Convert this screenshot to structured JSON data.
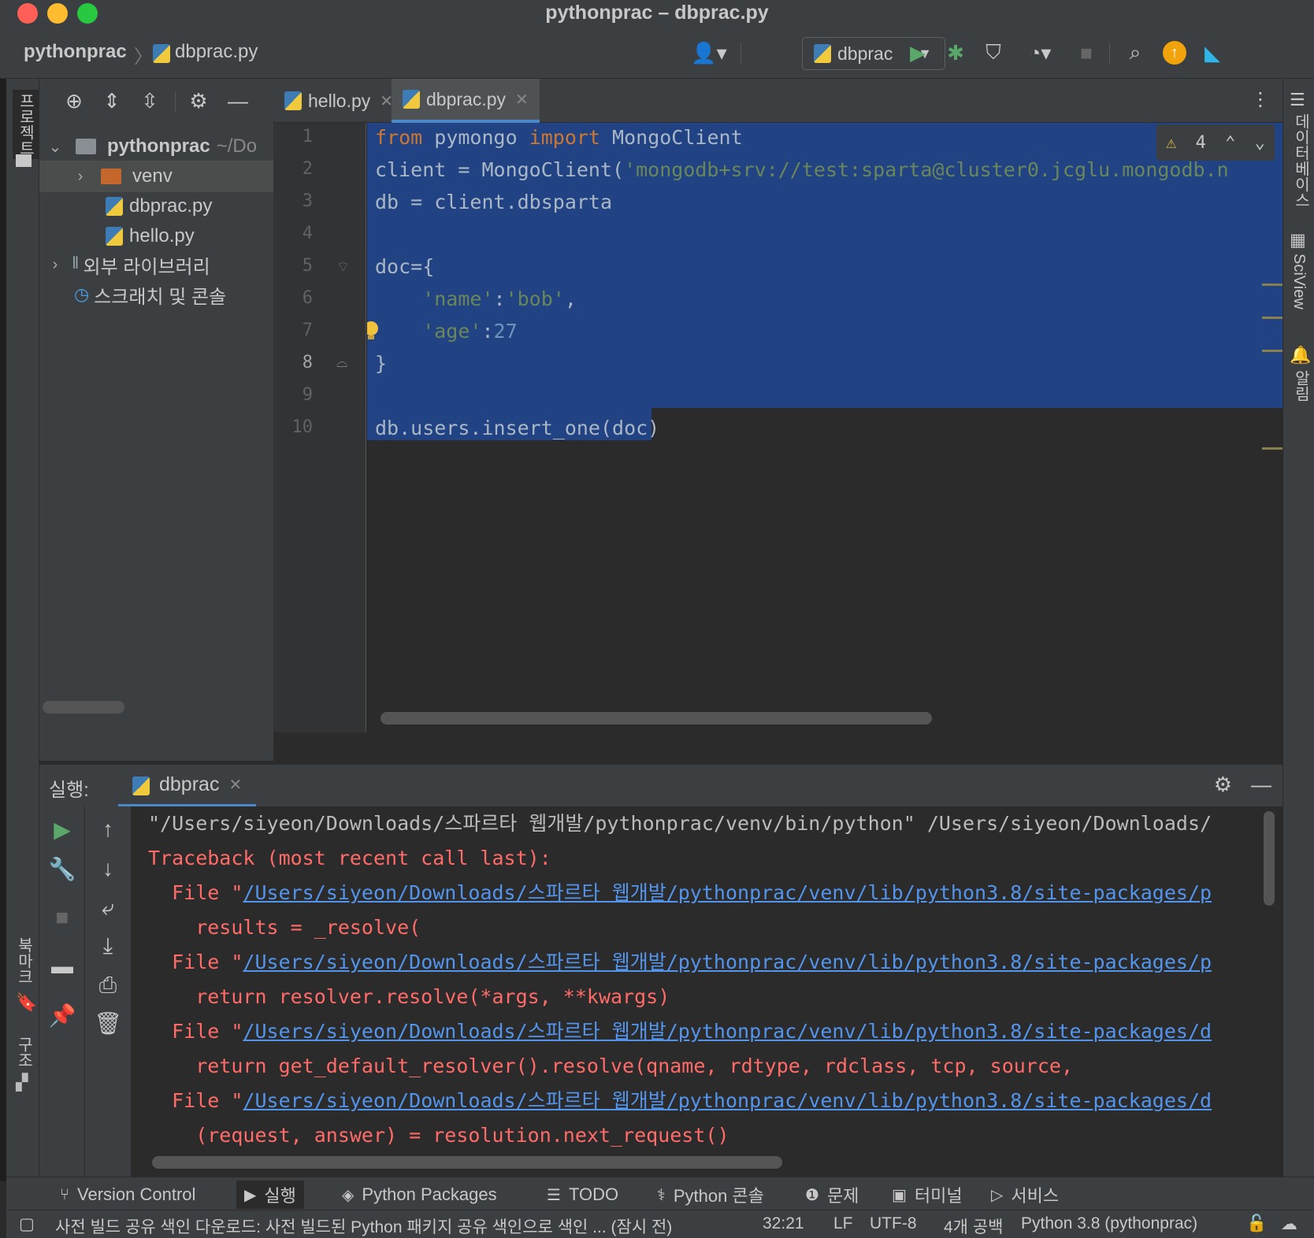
{
  "window": {
    "title": "pythonprac – dbprac.py"
  },
  "breadcrumb": {
    "project": "pythonprac",
    "file": "dbprac.py"
  },
  "toolbar": {
    "run_config": "dbprac"
  },
  "left_strip": {
    "project_label": "프로젝트",
    "bookmarks_label": "북마크",
    "structure_label": "구조"
  },
  "right_strip": {
    "database_label": "데이터베이스",
    "sciview_label": "SciView",
    "notifications_label": "알림"
  },
  "project_tree": {
    "root": {
      "name": "pythonprac",
      "path": "~/Do"
    },
    "items": [
      {
        "name": "venv"
      },
      {
        "name": "dbprac.py"
      },
      {
        "name": "hello.py"
      }
    ],
    "external_libraries": "외부 라이브러리",
    "scratches": "스크래치 및 콘솔"
  },
  "editor": {
    "tabs": [
      {
        "label": "hello.py"
      },
      {
        "label": "dbprac.py"
      }
    ],
    "warning_count": "4",
    "line_numbers": [
      "1",
      "2",
      "3",
      "4",
      "5",
      "6",
      "7",
      "8",
      "9",
      "10"
    ],
    "code": {
      "l1_kw1": "from",
      "l1_mid": " pymongo ",
      "l1_kw2": "import",
      "l1_end": " MongoClient",
      "l2_pre": "client = MongoClient(",
      "l2_str": "'mongodb+srv://test:sparta@cluster0.jcglu.mongodb.n",
      "l3": "db = client.dbsparta",
      "l5": "doc={",
      "l6_str1": "    'name'",
      "l6_colon": ":",
      "l6_str2": "'bob'",
      "l6_end": ",",
      "l7_str": "    'age'",
      "l7_colon": ":",
      "l7_num": "27",
      "l8": "}",
      "l10": "db.users.insert_one(doc)"
    }
  },
  "run_panel": {
    "title": "실행:",
    "tab_label": "dbprac",
    "output": {
      "cmd": "\"/Users/siyeon/Downloads/스파르타 웹개발/pythonprac/venv/bin/python\" /Users/siyeon/Downloads/",
      "traceback": "Traceback (most recent call last):",
      "file_prefix": "  File \"",
      "link1": "/Users/siyeon/Downloads/스파르타 웹개발/pythonprac/venv/lib/python3.8/site-packages/p",
      "code1": "    results = _resolve(",
      "link2": "/Users/siyeon/Downloads/스파르타 웹개발/pythonprac/venv/lib/python3.8/site-packages/p",
      "code2": "    return resolver.resolve(*args, **kwargs)",
      "link3": "/Users/siyeon/Downloads/스파르타 웹개발/pythonprac/venv/lib/python3.8/site-packages/d",
      "code3": "    return get_default_resolver().resolve(qname, rdtype, rdclass, tcp, source,",
      "link4": "/Users/siyeon/Downloads/스파르타 웹개발/pythonprac/venv/lib/python3.8/site-packages/d",
      "code4": "    (request, answer) = resolution.next_request()"
    }
  },
  "tool_windows": [
    {
      "label": "Version Control",
      "icon": "branch-icon"
    },
    {
      "label": "실행",
      "icon": "play-icon"
    },
    {
      "label": "Python Packages",
      "icon": "layers-icon"
    },
    {
      "label": "TODO",
      "icon": "list-icon"
    },
    {
      "label": "Python 콘솔",
      "icon": "python-icon"
    },
    {
      "label": "문제",
      "icon": "info-icon"
    },
    {
      "label": "터미널",
      "icon": "terminal-icon"
    },
    {
      "label": "서비스",
      "icon": "services-icon"
    }
  ],
  "status_bar": {
    "message": "사전 빌드 공유 색인 다운로드: 사전 빌드된 Python 패키지 공유 색인으로 색인 ... (잠시 전)",
    "position": "32:21",
    "line_sep": "LF",
    "encoding": "UTF-8",
    "indent": "4개 공백",
    "interpreter": "Python 3.8 (pythonprac)"
  },
  "colors": {
    "selection": "#214283",
    "keyword": "#cc7832",
    "string": "#6a8759",
    "number": "#6897bb",
    "error": "#ff6b68",
    "link": "#5394ec",
    "accent": "#4a88c7"
  }
}
